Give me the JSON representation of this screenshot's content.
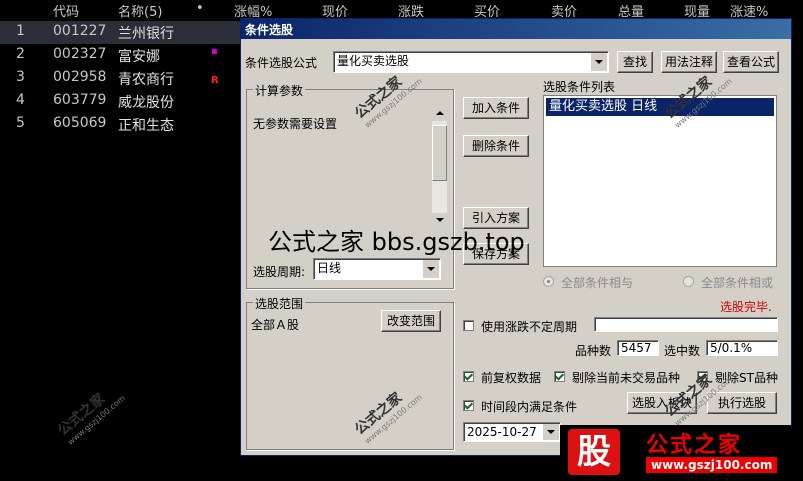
{
  "table": {
    "headers": [
      "代码",
      "名称(5)",
      "•",
      "涨幅%",
      "现价",
      "涨跌",
      "买价",
      "卖价",
      "总量",
      "现量",
      "涨速%"
    ],
    "rows": [
      {
        "idx": "1",
        "code": "001227",
        "name": "兰州银行"
      },
      {
        "idx": "2",
        "code": "002327",
        "name": "富安娜"
      },
      {
        "idx": "3",
        "code": "002958",
        "name": "青农商行"
      },
      {
        "idx": "4",
        "code": "603779",
        "name": "威龙股份"
      },
      {
        "idx": "5",
        "code": "605069",
        "name": "正和生态"
      }
    ],
    "marks": {
      "row2": "▪",
      "row3": "R"
    }
  },
  "dialog": {
    "title": "条件选股",
    "formula_label": "条件选股公式",
    "formula_value": "量化买卖选股",
    "btn_search": "查找",
    "btn_usage": "用法注释",
    "btn_view": "查看公式",
    "params_title": "计算参数",
    "params_text": "无参数需要设置",
    "period_label": "选股周期:",
    "period_value": "日线",
    "list_title": "选股条件列表",
    "list_item": "量化买卖选股  日线",
    "btn_add": "加入条件",
    "btn_delete": "删除条件",
    "btn_import": "引入方案",
    "btn_save": "保存方案",
    "radio_and": "全部条件相与",
    "radio_or": "全部条件相或",
    "status": "选股完毕.",
    "range_title": "选股范围",
    "range_value": "全部Ａ股",
    "btn_range": "改变范围",
    "chk_uncertain": "使用涨跌不定周期",
    "count_label": "品种数",
    "count_value": "5457",
    "selected_label": "选中数",
    "selected_value": "5/0.1%",
    "chk_adjust": "前复权数据",
    "chk_no_trade": "剔除当前未交易品种",
    "chk_st": "剔除ST品种",
    "chk_period": "时间段内满足条件",
    "date_value": "2025-10-27",
    "btn_to_block": "选股入板块",
    "btn_execute": "执行选股"
  },
  "overlay": "公式之家 bbs.gszb.top",
  "watermark": {
    "cn": "公式之家",
    "url": "www.gszj100.com"
  },
  "logo": {
    "gu": "股",
    "brand": "公式之家",
    "url": "www.gszj100.com"
  },
  "colors": {
    "accent": "#0a246a",
    "status": "#d00000",
    "mark_pink": "#d000d0",
    "mark_red": "#ff2020"
  }
}
